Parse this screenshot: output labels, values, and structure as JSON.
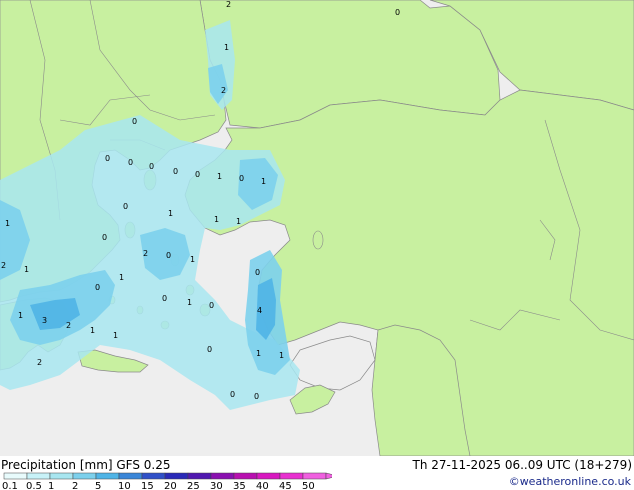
{
  "title": {
    "left": "Precipitation [mm] GFS 0.25",
    "right": "Th 27-11-2025 06..09 UTC (18+279)"
  },
  "credit": "©weatheronline.co.uk",
  "colors": {
    "sea": "#eeeeee",
    "land": "#c8f0a0",
    "border": "#8a8a8a",
    "precip_light": "#a8e6f0",
    "precip_mid": "#7cd0ec",
    "precip_strong": "#4fb4e6"
  },
  "legend": {
    "labels": [
      "0.1",
      "0.5",
      "1",
      "2",
      "5",
      "10",
      "15",
      "20",
      "25",
      "30",
      "35",
      "40",
      "45",
      "50"
    ],
    "colors": [
      "#e8fbfc",
      "#c8f2f8",
      "#a8e6f0",
      "#7cd0ec",
      "#4fb4e6",
      "#3a86d8",
      "#3050c8",
      "#2a2ab8",
      "#5018b0",
      "#8a10b0",
      "#b810b0",
      "#d818c0",
      "#e830d0",
      "#f060e0"
    ]
  },
  "values": [
    {
      "text": "2"
    },
    {
      "text": "0"
    },
    {
      "text": "1"
    },
    {
      "text": "2"
    },
    {
      "text": "0"
    },
    {
      "text": "0"
    },
    {
      "text": "0"
    },
    {
      "text": "0"
    },
    {
      "text": "0"
    },
    {
      "text": "0"
    },
    {
      "text": "1"
    },
    {
      "text": "0"
    },
    {
      "text": "1"
    },
    {
      "text": "0"
    },
    {
      "text": "1"
    },
    {
      "text": "1"
    },
    {
      "text": "1"
    },
    {
      "text": "1"
    },
    {
      "text": "0"
    },
    {
      "text": "2"
    },
    {
      "text": "0"
    },
    {
      "text": "1"
    },
    {
      "text": "2"
    },
    {
      "text": "1"
    },
    {
      "text": "0"
    },
    {
      "text": "1"
    },
    {
      "text": "0"
    },
    {
      "text": "1"
    },
    {
      "text": "3"
    },
    {
      "text": "2"
    },
    {
      "text": "1"
    },
    {
      "text": "1"
    },
    {
      "text": "4"
    },
    {
      "text": "1"
    },
    {
      "text": "2"
    },
    {
      "text": "0"
    },
    {
      "text": "0"
    },
    {
      "text": "0"
    },
    {
      "text": "1"
    },
    {
      "text": "1"
    },
    {
      "text": "0"
    },
    {
      "text": "0"
    }
  ]
}
